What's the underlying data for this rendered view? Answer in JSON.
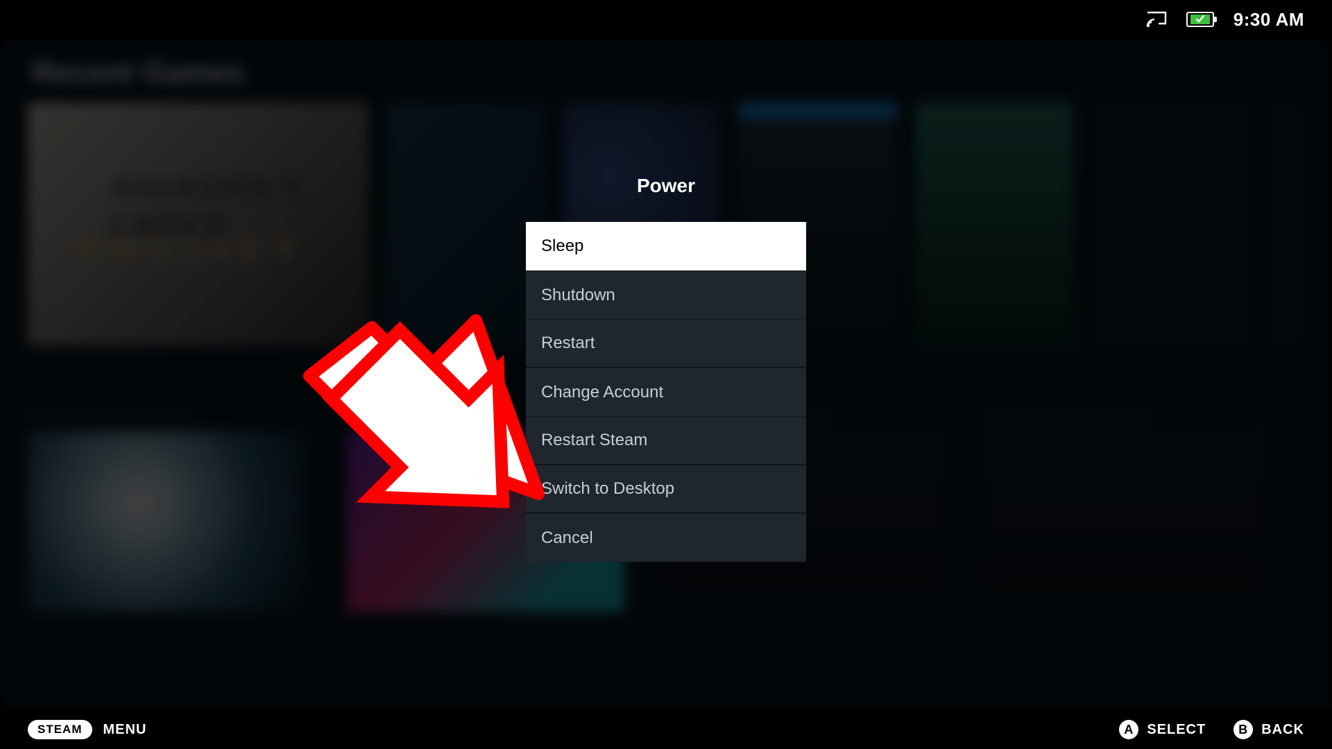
{
  "statusbar": {
    "time": "9:30 AM"
  },
  "library": {
    "section_title": "Recent Games",
    "hero_game": {
      "franchise": "ASSASSIN'S CREED",
      "title": "ODYSSEY"
    }
  },
  "power_menu": {
    "title": "Power",
    "items": [
      {
        "label": "Sleep",
        "selected": true
      },
      {
        "label": "Shutdown",
        "selected": false
      },
      {
        "label": "Restart",
        "selected": false
      },
      {
        "label": "Change Account",
        "selected": false
      },
      {
        "label": "Restart Steam",
        "selected": false
      },
      {
        "label": "Switch to Desktop",
        "selected": false
      },
      {
        "label": "Cancel",
        "selected": false
      }
    ]
  },
  "annotation": {
    "arrow_target": "Switch to Desktop",
    "arrow_color_stroke": "#ff0000",
    "arrow_color_fill": "#ffffff"
  },
  "hintbar": {
    "steam_pill": "STEAM",
    "menu_label": "MENU",
    "a_label": "SELECT",
    "b_label": "BACK",
    "a_glyph": "A",
    "b_glyph": "B"
  }
}
